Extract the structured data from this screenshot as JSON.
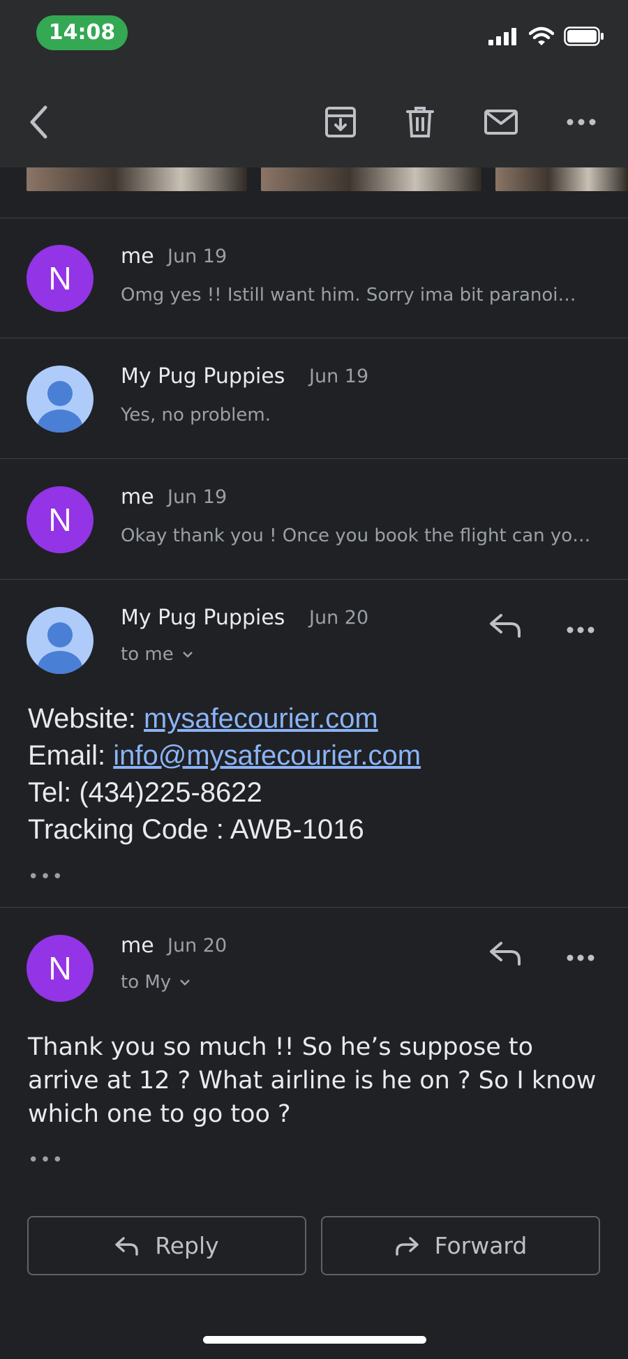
{
  "status_bar": {
    "time": "14:08"
  },
  "toolbar": {
    "back_icon": "chevron-left-icon",
    "archive_icon": "archive-icon",
    "delete_icon": "trash-icon",
    "mark_unread_icon": "mail-icon",
    "more_icon": "more-horizontal-icon"
  },
  "thread": {
    "collapsed": [
      {
        "avatar": "N",
        "sender": "me",
        "date": "Jun 19",
        "snippet": "Omg yes !! Istill want him. Sorry ima bit paranoid about the flight"
      },
      {
        "avatar": "person",
        "sender": "My Pug Puppies",
        "date": "Jun 19",
        "snippet": "Yes, no problem."
      },
      {
        "avatar": "N",
        "sender": "me",
        "date": "Jun 19",
        "snippet": "Okay thank you ! Once you book the flight can you send me the info"
      }
    ],
    "expanded": [
      {
        "sender": "My Pug Puppies",
        "date": "Jun 20",
        "to": "to me",
        "lines": {
          "website_label": "Website: ",
          "website_link": "mysafecourier.com",
          "email_label": "Email: ",
          "email_link": "info@mysafecourier.com",
          "tel": "Tel: (434)225-8622",
          "tracking": "Tracking Code : AWB-1016"
        },
        "trimmed": "•••"
      },
      {
        "avatar": "N",
        "sender": "me",
        "date": "Jun 20",
        "to": "to My",
        "body": "Thank you so much !! So he’s suppose to arrive at 12 ? What airline is he on ? So I know which one to go too ?",
        "trimmed": "•••"
      }
    ]
  },
  "actions": {
    "reply": "Reply",
    "forward": "Forward"
  },
  "colors": {
    "background": "#202124",
    "link": "#8ab4f8",
    "avatar_me": "#9334e6",
    "avatar_contact": "#aecbfa",
    "time_pill": "#34a853"
  }
}
